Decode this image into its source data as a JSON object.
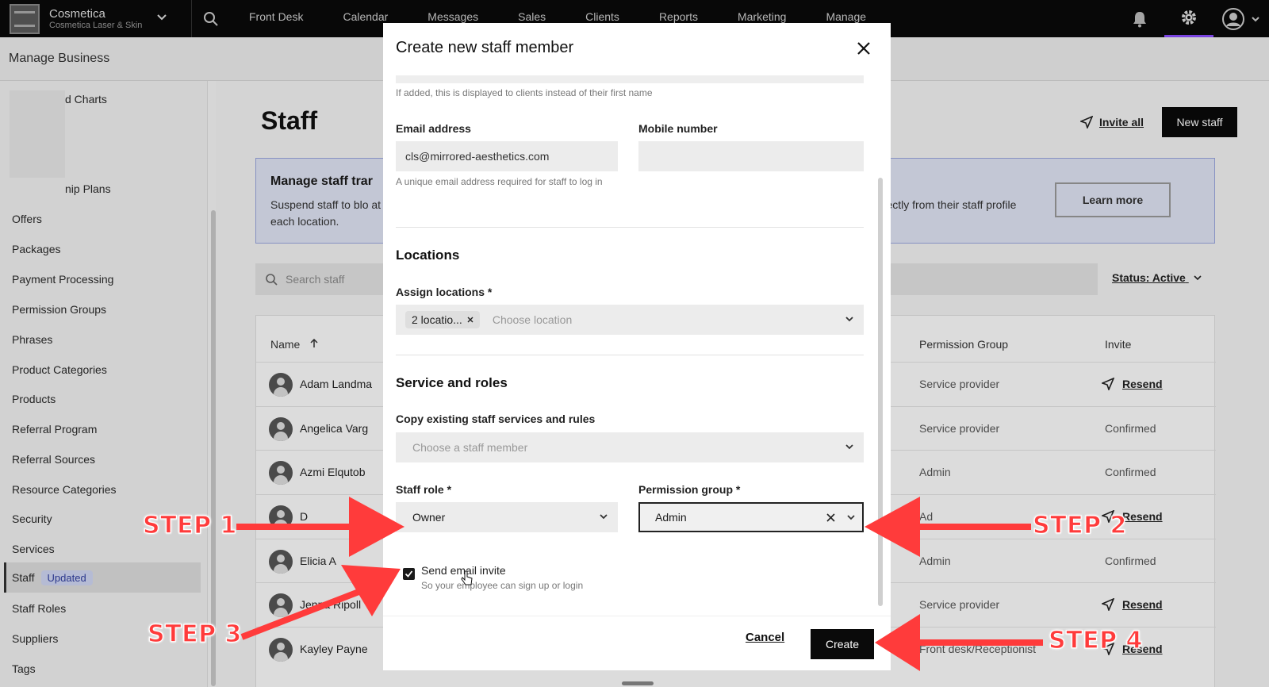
{
  "topbar": {
    "brand_name": "Cosmetica",
    "brand_sub": "Cosmetica Laser & Skin",
    "nav": [
      "Front Desk",
      "Calendar",
      "Messages",
      "Sales",
      "Clients",
      "Reports",
      "Marketing",
      "Manage"
    ]
  },
  "subheader": {
    "title": "Manage Business"
  },
  "sidebar": {
    "partial_items": [
      "d Charts",
      "nip Plans"
    ],
    "items": [
      "Offers",
      "Packages",
      "Payment Processing",
      "Permission Groups",
      "Phrases",
      "Product Categories",
      "Products",
      "Referral Program",
      "Referral Sources",
      "Resource Categories",
      "Security",
      "Services",
      "Staff",
      "Staff Roles",
      "Suppliers",
      "Tags"
    ],
    "staff_badge": "Updated"
  },
  "main": {
    "title": "Staff",
    "invite_all": "Invite all",
    "new_staff": "New staff",
    "banner_title": "Manage staff trar",
    "banner_text": "Suspend staff to blo at each location.",
    "banner_right": "s directly from their staff profile",
    "learn_more": "Learn more",
    "search_placeholder": "Search staff",
    "status_filter": "Status: Active",
    "columns": {
      "name": "Name",
      "permission": "Permission Group",
      "invite": "Invite"
    },
    "rows": [
      {
        "name": "Adam Landma",
        "permission": "Service provider",
        "invite": "Resend"
      },
      {
        "name": "Angelica Varg",
        "permission": "Service provider",
        "invite": "Confirmed"
      },
      {
        "name": "Azmi Elqutob",
        "permission": "Admin",
        "invite": "Confirmed"
      },
      {
        "name": "D",
        "permission": "Ad",
        "invite": "Resend"
      },
      {
        "name": "Elicia A",
        "permission": "Admin",
        "invite": "Confirmed"
      },
      {
        "name": "Jenna Ripoll",
        "permission": "Service provider",
        "invite": "Resend"
      },
      {
        "name": "Kayley Payne",
        "permission": "Front desk/Receptionist",
        "invite": "Resend"
      }
    ]
  },
  "modal": {
    "title": "Create new staff member",
    "preferred_name_hint": "If added, this is displayed to clients instead of their first name",
    "email_label": "Email address",
    "email_value": "cls@mirrored-aesthetics.com",
    "email_hint": "A unique email address required for staff to log in",
    "mobile_label": "Mobile number",
    "mobile_value": "",
    "locations_section": "Locations",
    "assign_locations_label": "Assign locations *",
    "locations_chip": "2 locatio...",
    "locations_placeholder": "Choose location",
    "service_section": "Service and roles",
    "copy_label": "Copy existing staff services and rules",
    "copy_placeholder": "Choose a staff member",
    "role_label": "Staff role *",
    "role_value": "Owner",
    "perm_label": "Permission group *",
    "perm_value": "Admin",
    "send_invite_label": "Send email invite",
    "send_invite_hint": "So your employee can sign up or login",
    "send_invite_checked": true,
    "cancel": "Cancel",
    "create": "Create"
  },
  "annotations": {
    "step1": "STEP 1",
    "step2": "STEP 2",
    "step3": "STEP 3",
    "step4": "STEP 4",
    "arrow_color": "#ff3b3b"
  }
}
